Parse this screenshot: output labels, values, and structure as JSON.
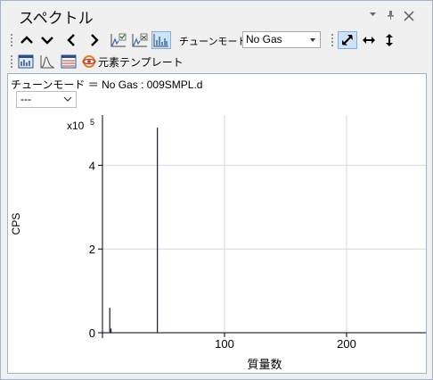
{
  "window": {
    "title": "スペクトル",
    "controls": {
      "menu": "▾",
      "pin": "📌",
      "close": "✕"
    }
  },
  "toolbar1": {
    "buttons": [
      {
        "name": "scroll-up-icon"
      },
      {
        "name": "scroll-down-icon"
      },
      {
        "name": "previous-icon"
      },
      {
        "name": "next-icon"
      },
      {
        "name": "spectrum-check-icon"
      },
      {
        "name": "spectrum-check-alt-icon"
      },
      {
        "name": "spectrum-bars-icon",
        "active": true
      }
    ],
    "tune_mode_label": "チューンモード:",
    "tune_mode_value": "No Gas",
    "zoom_buttons": [
      {
        "name": "zoom-both-icon",
        "active": true
      },
      {
        "name": "zoom-horizontal-icon"
      },
      {
        "name": "zoom-vertical-icon"
      }
    ]
  },
  "toolbar2": {
    "buttons": [
      {
        "name": "bar-chart-icon"
      },
      {
        "name": "peak-profile-icon"
      },
      {
        "name": "table-view-icon"
      }
    ],
    "element_template_label": "元素テンプレート"
  },
  "panel": {
    "tune_info": "チューンモード ＝  No Gas : 009SMPL.d",
    "combo_value": "---"
  },
  "chart_data": {
    "type": "bar",
    "xlabel": "質量数",
    "ylabel": "CPS",
    "y_multiplier_label": "x10",
    "y_multiplier_exponent": "5",
    "xlim": [
      0,
      265
    ],
    "ylim": [
      0,
      5.2
    ],
    "x_ticks": [
      {
        "value": 100,
        "label": "100"
      },
      {
        "value": 200,
        "label": "200"
      }
    ],
    "y_ticks": [
      {
        "value": 0,
        "label": "0"
      },
      {
        "value": 2,
        "label": "2"
      },
      {
        "value": 4,
        "label": "4"
      }
    ],
    "grid": true,
    "peaks": [
      {
        "mass": 6,
        "cps": 0.6
      },
      {
        "mass": 7,
        "cps": 0.1
      },
      {
        "mass": 45,
        "cps": 4.9
      }
    ],
    "colors": {
      "peak": "#1a1a3c",
      "grid": "#d8d8d8",
      "axis": "#000000"
    }
  }
}
